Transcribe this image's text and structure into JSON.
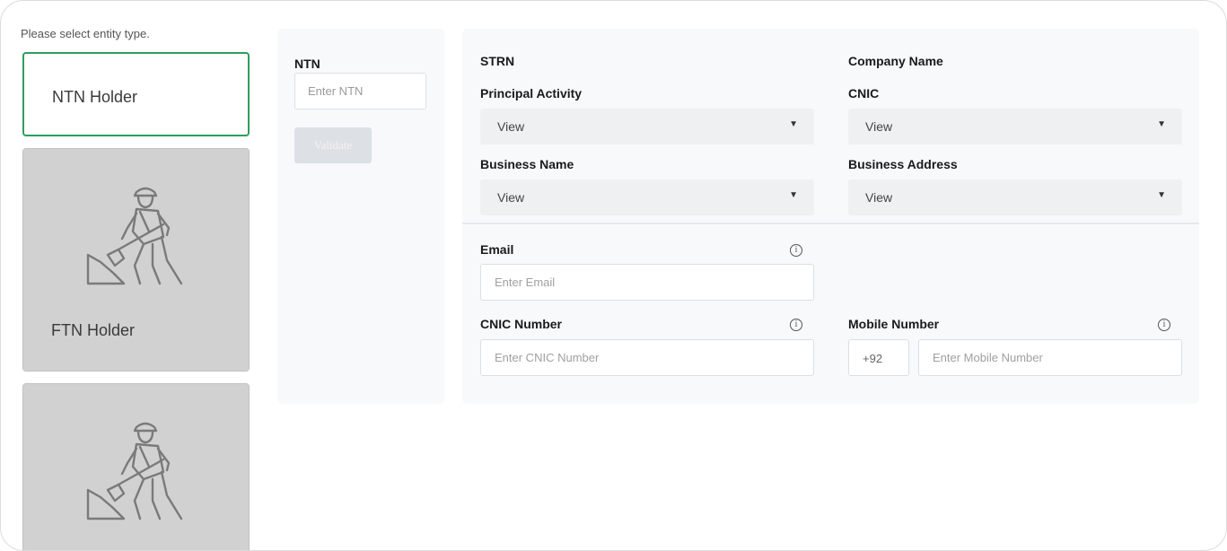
{
  "entity": {
    "prompt": "Please select entity type.",
    "cards": [
      {
        "label": "NTN Holder",
        "selected": true,
        "icon": "worker-shovel-icon"
      },
      {
        "label": "FTN Holder",
        "selected": false,
        "icon": "worker-shovel-icon"
      },
      {
        "label": "",
        "selected": false,
        "icon": "worker-shovel-icon"
      }
    ]
  },
  "ntn_panel": {
    "label": "NTN",
    "placeholder": "Enter NTN",
    "validate_label": "Validate"
  },
  "details": {
    "strn_label": "STRN",
    "company_name_label": "Company Name",
    "principal_activity": {
      "label": "Principal Activity",
      "value": "View"
    },
    "cnic": {
      "label": "CNIC",
      "value": "View"
    },
    "business_name": {
      "label": "Business Name",
      "value": "View"
    },
    "business_address": {
      "label": "Business Address",
      "value": "View"
    }
  },
  "contact": {
    "email": {
      "label": "Email",
      "placeholder": "Enter Email"
    },
    "cnic_number": {
      "label": "CNIC Number",
      "placeholder": "Enter CNIC Number"
    },
    "mobile": {
      "label": "Mobile Number",
      "prefix": "+92",
      "placeholder": "Enter Mobile Number"
    },
    "info_glyph": "i"
  },
  "colors": {
    "selected_border": "#2e9e5e",
    "card_disabled_bg": "#d1d1d1",
    "panel_bg": "#f7f9fb",
    "select_bg": "#eef0f2"
  }
}
